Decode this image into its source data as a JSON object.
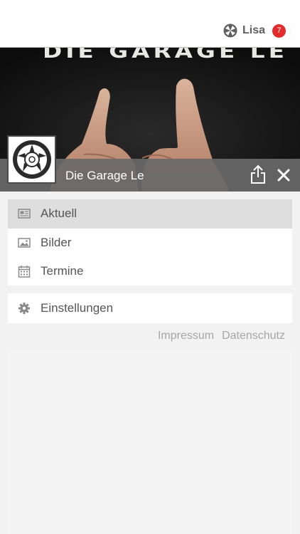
{
  "header": {
    "user_name": "Lisa",
    "notification_count": "7",
    "accent_color": "#e32b2b"
  },
  "hero": {
    "banner_text": "DIE GARAGE LE",
    "group_title": "Die Garage Le"
  },
  "menu": {
    "items": [
      {
        "label": "Aktuell",
        "icon": "newspaper-icon",
        "active": true
      },
      {
        "label": "Bilder",
        "icon": "image-icon",
        "active": false
      },
      {
        "label": "Termine",
        "icon": "calendar-icon",
        "active": false
      }
    ],
    "settings": {
      "label": "Einstellungen",
      "icon": "gear-icon"
    }
  },
  "footer": {
    "impressum": "Impressum",
    "datenschutz": "Datenschutz"
  }
}
